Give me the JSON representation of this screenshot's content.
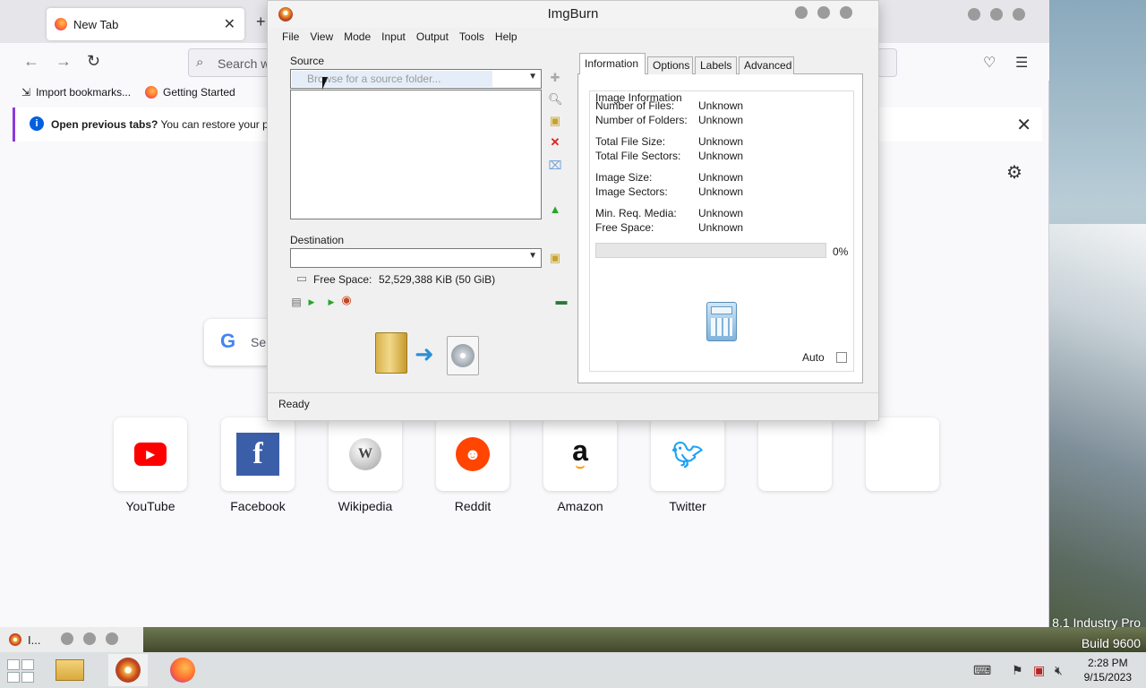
{
  "firefox": {
    "tab_title": "New Tab",
    "url_placeholder": "Search w",
    "bookmarks": [
      "Import bookmarks...",
      "Getting Started"
    ],
    "notice_bold": "Open previous tabs?",
    "notice_text": "You can restore your prev",
    "search_text": "Se",
    "shortcuts": [
      "YouTube",
      "Facebook",
      "Wikipedia",
      "Reddit",
      "Amazon",
      "Twitter"
    ]
  },
  "imgburn": {
    "title": "ImgBurn",
    "menu": [
      "File",
      "View",
      "Mode",
      "Input",
      "Output",
      "Tools",
      "Help"
    ],
    "source_label": "Source",
    "source_placeholder": "Browse for a source folder...",
    "destination_label": "Destination",
    "free_space_label": "Free Space:",
    "free_space_value": "52,529,388 KiB  (50 GiB)",
    "tabs": [
      "Information",
      "Options",
      "Labels",
      "Advanced"
    ],
    "info_header": "Image Information",
    "info_rows": [
      {
        "label": "Number of Files:",
        "value": "Unknown"
      },
      {
        "label": "Number of Folders:",
        "value": "Unknown"
      },
      {
        "label": "Total File Size:",
        "value": "Unknown"
      },
      {
        "label": "Total File Sectors:",
        "value": "Unknown"
      },
      {
        "label": "Image Size:",
        "value": "Unknown"
      },
      {
        "label": "Image Sectors:",
        "value": "Unknown"
      },
      {
        "label": "Min. Req. Media:",
        "value": "Unknown"
      },
      {
        "label": "Free Space:",
        "value": "Unknown"
      }
    ],
    "progress_percent": 0,
    "progress_label": "0%",
    "auto_label": "Auto",
    "status": "Ready"
  },
  "desktop": {
    "os_line1": "8.1 Industry Pro",
    "os_line2": "Build 9600"
  },
  "taskbar": {
    "mini_label": "I...",
    "time": "2:28 PM",
    "date": "9/15/2023"
  }
}
